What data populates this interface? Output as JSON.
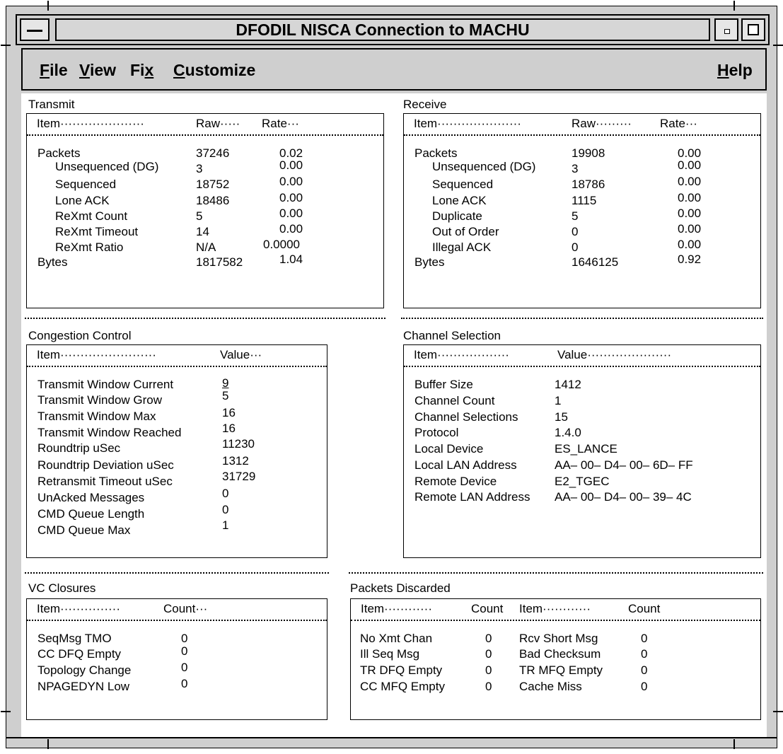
{
  "window": {
    "title": "DFODIL NISCA Connection to MACHU"
  },
  "menu": {
    "file": {
      "accel": "F",
      "rest": "ile"
    },
    "view": {
      "accel": "V",
      "rest": "iew"
    },
    "fix": {
      "pre": "Fi",
      "accel": "x"
    },
    "customize": {
      "accel": "C",
      "rest": "ustomize"
    },
    "help": {
      "accel": "H",
      "rest": "elp"
    }
  },
  "transmit": {
    "title": "Transmit",
    "headers": {
      "item": "Item·····················",
      "raw": "Raw·····",
      "rate": "Rate···"
    },
    "rows": [
      {
        "item": "Packets",
        "raw": "37246",
        "rate": "0.02"
      },
      {
        "item": "Unsequenced (DG)",
        "raw": "3",
        "rate": "0.00"
      },
      {
        "item": "Sequenced",
        "raw": "18752",
        "rate": "0.00"
      },
      {
        "item": "Lone ACK",
        "raw": "18486",
        "rate": "0.00"
      },
      {
        "item": "ReXmt Count",
        "raw": "5",
        "rate": "0.00"
      },
      {
        "item": "ReXmt Timeout",
        "raw": "14",
        "rate": "0.00"
      },
      {
        "item": "ReXmt Ratio",
        "raw": "N/A",
        "rate": "0.0000"
      },
      {
        "item": "Bytes",
        "raw": "1817582",
        "rate": "1.04"
      }
    ]
  },
  "receive": {
    "title": "Receive",
    "headers": {
      "item": "Item·····················",
      "raw": "Raw·········",
      "rate": "Rate···"
    },
    "rows": [
      {
        "item": "Packets",
        "raw": "19908",
        "rate": "0.00"
      },
      {
        "item": "Unsequenced (DG)",
        "raw": "3",
        "rate": "0.00"
      },
      {
        "item": "Sequenced",
        "raw": "18786",
        "rate": "0.00"
      },
      {
        "item": "Lone ACK",
        "raw": "1115",
        "rate": "0.00"
      },
      {
        "item": "Duplicate",
        "raw": "5",
        "rate": "0.00"
      },
      {
        "item": "Out of Order",
        "raw": "0",
        "rate": "0.00"
      },
      {
        "item": "Illegal ACK",
        "raw": "0",
        "rate": "0.00"
      },
      {
        "item": "Bytes",
        "raw": "1646125",
        "rate": "0.92"
      }
    ]
  },
  "congestion": {
    "title": "Congestion Control",
    "headers": {
      "item": "Item························",
      "value": "Value···"
    },
    "rows": [
      {
        "item": "Transmit Window Current",
        "value": "9"
      },
      {
        "item": "Transmit Window Grow",
        "value": "5"
      },
      {
        "item": "Transmit Window Max",
        "value": "16"
      },
      {
        "item": "Transmit Window Reached",
        "value": "16"
      },
      {
        "item": "Roundtrip uSec",
        "value": "11230"
      },
      {
        "item": "Roundtrip Deviation uSec",
        "value": "1312"
      },
      {
        "item": "Retransmit Timeout uSec",
        "value": "31729"
      },
      {
        "item": "UnAcked Messages",
        "value": "0"
      },
      {
        "item": "CMD Queue Length",
        "value": "0"
      },
      {
        "item": "CMD Queue Max",
        "value": "1"
      }
    ]
  },
  "channel": {
    "title": "Channel Selection",
    "headers": {
      "item": "Item··················",
      "value": "Value·····················"
    },
    "rows": [
      {
        "item": "Buffer Size",
        "value": "1412"
      },
      {
        "item": "Channel Count",
        "value": "1"
      },
      {
        "item": "Channel Selections",
        "value": "15"
      },
      {
        "item": "Protocol",
        "value": "1.4.0"
      },
      {
        "item": "Local Device",
        "value": "ES_LANCE"
      },
      {
        "item": "Local LAN Address",
        "value": "AA– 00– D4– 00– 6D– FF"
      },
      {
        "item": "Remote Device",
        "value": "E2_TGEC"
      },
      {
        "item": "Remote LAN Address",
        "value": "AA– 00– D4– 00– 39– 4C"
      }
    ]
  },
  "vc_closures": {
    "title": "VC Closures",
    "headers": {
      "item": "Item···············",
      "count": "Count···"
    },
    "rows": [
      {
        "item": "SeqMsg TMO",
        "count": "0"
      },
      {
        "item": "CC DFQ Empty",
        "count": "0"
      },
      {
        "item": "Topology Change",
        "count": "0"
      },
      {
        "item": "NPAGEDYN Low",
        "count": "0"
      }
    ]
  },
  "discarded": {
    "title": "Packets Discarded",
    "headers": {
      "item1": "Item············",
      "count1": "Count",
      "item2": "Item············",
      "count2": "Count"
    },
    "rows": [
      {
        "item1": "No Xmt Chan",
        "count1": "0",
        "item2": "Rcv Short Msg",
        "count2": "0"
      },
      {
        "item1": "Ill Seq Msg",
        "count1": "0",
        "item2": "Bad Checksum",
        "count2": "0"
      },
      {
        "item1": "TR DFQ Empty",
        "count1": "0",
        "item2": "TR MFQ Empty",
        "count2": "0"
      },
      {
        "item1": "CC MFQ Empty",
        "count1": "0",
        "item2": "Cache Miss",
        "count2": "0"
      }
    ]
  }
}
